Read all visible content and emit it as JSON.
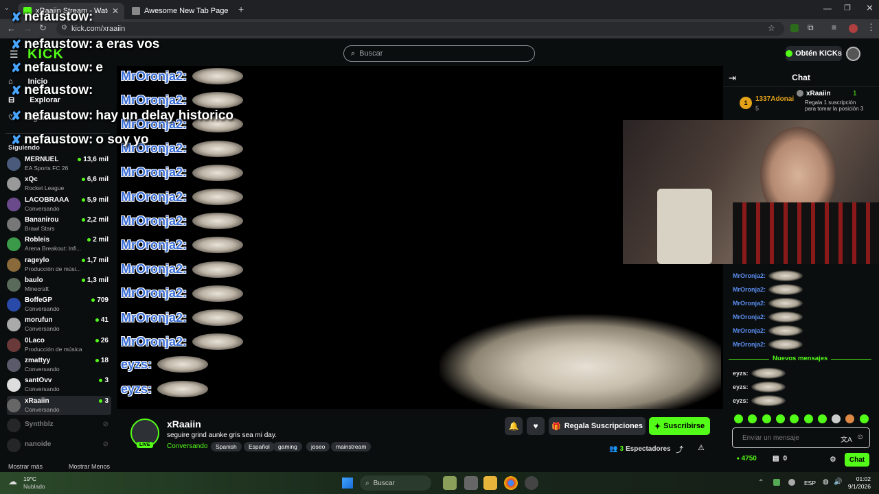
{
  "browser": {
    "tabs": [
      {
        "title": "xRaaiin Stream - Watch Live on",
        "active": true
      },
      {
        "title": "Awesome New Tab Page",
        "active": false
      }
    ],
    "url": "kick.com/xraaiin"
  },
  "header": {
    "logo": "KICK",
    "search_placeholder": "Buscar",
    "get_kicks": "Obtén KICKs"
  },
  "sidebar": {
    "nav": [
      {
        "label": "Inicio",
        "icon": "home-icon"
      },
      {
        "label": "Explorar",
        "icon": "compass-icon"
      },
      {
        "label": "Siguiendo",
        "icon": "heart-icon"
      }
    ],
    "following_title": "Siguiendo",
    "following": [
      {
        "name": "MERNUEL",
        "sub": "EA Sports FC 26",
        "count": "13,6 mil",
        "live": true
      },
      {
        "name": "xQc",
        "sub": "Rocket League",
        "count": "6,6 mil",
        "live": true
      },
      {
        "name": "LACOBRAAA",
        "sub": "Conversando",
        "count": "5,9 mil",
        "live": true
      },
      {
        "name": "Bananirou",
        "sub": "Brawl Stars",
        "count": "2,2 mil",
        "live": true
      },
      {
        "name": "Robleis",
        "sub": "Arena Breakout: Infi...",
        "count": "2 mil",
        "live": true
      },
      {
        "name": "rageylo",
        "sub": "Producción de músi...",
        "count": "1,7 mil",
        "live": true
      },
      {
        "name": "baulo",
        "sub": "Minecraft",
        "count": "1,3 mil",
        "live": true
      },
      {
        "name": "BoffeGP",
        "sub": "Conversando",
        "count": "709",
        "live": true
      },
      {
        "name": "morufun",
        "sub": "Conversando",
        "count": "41",
        "live": true
      },
      {
        "name": "0Laco",
        "sub": "Producción de música",
        "count": "26",
        "live": true
      },
      {
        "name": "zmattyy",
        "sub": "Conversando",
        "count": "18",
        "live": true
      },
      {
        "name": "santOvv",
        "sub": "Conversando",
        "count": "3",
        "live": true
      },
      {
        "name": "xRaaiin",
        "sub": "Conversando",
        "count": "3",
        "live": true
      },
      {
        "name": "Synthblz",
        "sub": "",
        "count": "",
        "live": false
      },
      {
        "name": "nanoide",
        "sub": "",
        "count": "",
        "live": false
      }
    ],
    "show_more": "Mostrar más",
    "show_less": "Mostrar Menos"
  },
  "overlay_chat": [
    {
      "name": "nefaustow:",
      "text": ""
    },
    {
      "name": "nefaustow:",
      "text": "a eras vos"
    },
    {
      "name": "nefaustow:",
      "text": "e"
    },
    {
      "name": "nefaustow:",
      "text": ""
    },
    {
      "name": "nefaustow:",
      "text": "hay un delay historico"
    },
    {
      "name": "nefaustow:",
      "text": "o soy yo"
    }
  ],
  "video_chat": [
    "MrOronja2:",
    "MrOronja2:",
    "MrOronja2:",
    "MrOronja2:",
    "MrOronja2:",
    "MrOronja2:",
    "MrOronja2:",
    "MrOronja2:",
    "MrOronja2:",
    "MrOronja2:",
    "MrOronja2:",
    "MrOronja2:",
    "eyzs:",
    "eyzs:"
  ],
  "stream": {
    "streamer": "xRaaiin",
    "title": "seguire grind aunke gris sea mi day.",
    "category": "Conversando",
    "live_badge": "LIVE",
    "tags": [
      "Spanish",
      "Español",
      "gaming",
      "joseo",
      "mainstream"
    ],
    "gift_subs": "Regala Suscripciones",
    "subscribe": "Suscribirse",
    "viewers_count": "3",
    "viewers_label": "Espectadores"
  },
  "chat": {
    "title": "Chat",
    "leaderboard": {
      "rank": "1",
      "top_user": "1337Adonai",
      "top_count": "5",
      "gift_user": "xRaaiin",
      "gift_count": "1",
      "gift_text": "Regala 1 suscripción para tomar la posición 3"
    },
    "messages": [
      "MrOronja2:",
      "MrOronja2:",
      "MrOronja2:",
      "MrOronja2:",
      "MrOronja2:",
      "MrOronja2:"
    ],
    "new_messages": "Nuevos mensajes",
    "new": [
      "eyzs:",
      "eyzs:",
      "eyzs:"
    ],
    "input_placeholder": "Enviar un mensaje",
    "kicks_balance": "4750",
    "points": "0",
    "send": "Chat"
  },
  "taskbar": {
    "temp": "19°C",
    "weather": "Nublado",
    "search": "Buscar",
    "lang": "ESP",
    "time": "01:02",
    "date": "9/1/2026"
  },
  "colors": {
    "accent": "#53fc18",
    "bg": "#0b0e0f",
    "name_blue": "#3b6fd6"
  }
}
